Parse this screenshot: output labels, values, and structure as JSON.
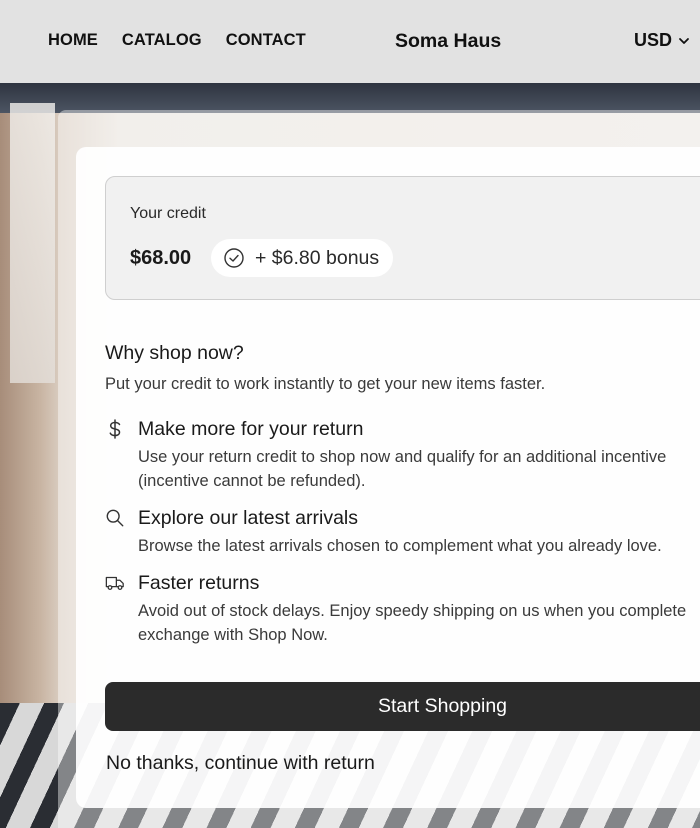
{
  "header": {
    "nav": [
      "HOME",
      "CATALOG",
      "CONTACT"
    ],
    "brand": "Soma Haus",
    "currency": "USD"
  },
  "credit": {
    "label": "Your credit",
    "amount": "$68.00",
    "bonus": "+ $6.80 bonus"
  },
  "why": {
    "title": "Why shop now?",
    "subtitle": "Put your credit to work instantly to get your new items faster."
  },
  "benefits": [
    {
      "icon": "dollar-icon",
      "title": "Make more for your return",
      "text_line1": "Use your return credit to shop now and qualify for an additional incentive",
      "text_line2": "(incentive cannot be refunded)."
    },
    {
      "icon": "search-icon",
      "title": "Explore our latest arrivals",
      "text_line1": "Browse the latest arrivals chosen to complement what you already love."
    },
    {
      "icon": "truck-icon",
      "title": "Faster returns",
      "text_line1": "Avoid out of stock delays. Enjoy speedy shipping on us when you complete",
      "text_line2": "exchange with Shop Now."
    }
  ],
  "actions": {
    "start": "Start Shopping",
    "decline": "No thanks, continue with return"
  }
}
